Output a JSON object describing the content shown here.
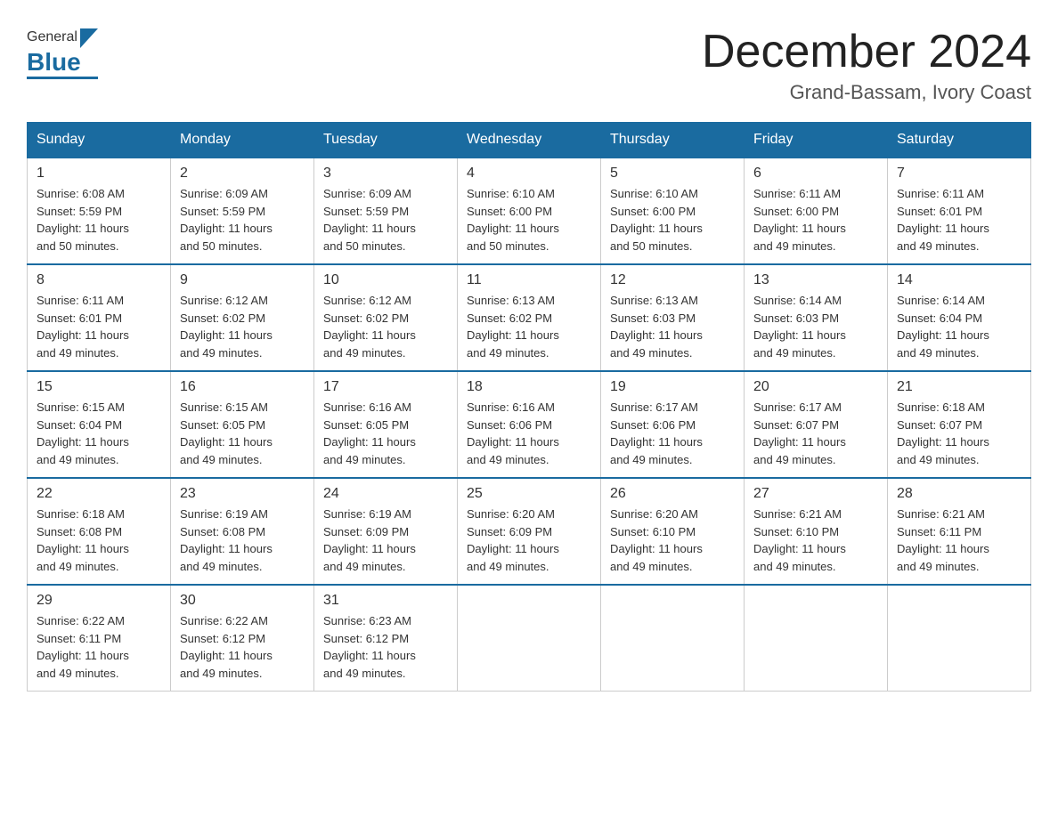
{
  "header": {
    "logo_general": "General",
    "logo_blue": "Blue",
    "month_title": "December 2024",
    "location": "Grand-Bassam, Ivory Coast"
  },
  "days_of_week": [
    "Sunday",
    "Monday",
    "Tuesday",
    "Wednesday",
    "Thursday",
    "Friday",
    "Saturday"
  ],
  "weeks": [
    [
      {
        "day": "1",
        "sunrise": "6:08 AM",
        "sunset": "5:59 PM",
        "daylight": "11 hours and 50 minutes."
      },
      {
        "day": "2",
        "sunrise": "6:09 AM",
        "sunset": "5:59 PM",
        "daylight": "11 hours and 50 minutes."
      },
      {
        "day": "3",
        "sunrise": "6:09 AM",
        "sunset": "5:59 PM",
        "daylight": "11 hours and 50 minutes."
      },
      {
        "day": "4",
        "sunrise": "6:10 AM",
        "sunset": "6:00 PM",
        "daylight": "11 hours and 50 minutes."
      },
      {
        "day": "5",
        "sunrise": "6:10 AM",
        "sunset": "6:00 PM",
        "daylight": "11 hours and 50 minutes."
      },
      {
        "day": "6",
        "sunrise": "6:11 AM",
        "sunset": "6:00 PM",
        "daylight": "11 hours and 49 minutes."
      },
      {
        "day": "7",
        "sunrise": "6:11 AM",
        "sunset": "6:01 PM",
        "daylight": "11 hours and 49 minutes."
      }
    ],
    [
      {
        "day": "8",
        "sunrise": "6:11 AM",
        "sunset": "6:01 PM",
        "daylight": "11 hours and 49 minutes."
      },
      {
        "day": "9",
        "sunrise": "6:12 AM",
        "sunset": "6:02 PM",
        "daylight": "11 hours and 49 minutes."
      },
      {
        "day": "10",
        "sunrise": "6:12 AM",
        "sunset": "6:02 PM",
        "daylight": "11 hours and 49 minutes."
      },
      {
        "day": "11",
        "sunrise": "6:13 AM",
        "sunset": "6:02 PM",
        "daylight": "11 hours and 49 minutes."
      },
      {
        "day": "12",
        "sunrise": "6:13 AM",
        "sunset": "6:03 PM",
        "daylight": "11 hours and 49 minutes."
      },
      {
        "day": "13",
        "sunrise": "6:14 AM",
        "sunset": "6:03 PM",
        "daylight": "11 hours and 49 minutes."
      },
      {
        "day": "14",
        "sunrise": "6:14 AM",
        "sunset": "6:04 PM",
        "daylight": "11 hours and 49 minutes."
      }
    ],
    [
      {
        "day": "15",
        "sunrise": "6:15 AM",
        "sunset": "6:04 PM",
        "daylight": "11 hours and 49 minutes."
      },
      {
        "day": "16",
        "sunrise": "6:15 AM",
        "sunset": "6:05 PM",
        "daylight": "11 hours and 49 minutes."
      },
      {
        "day": "17",
        "sunrise": "6:16 AM",
        "sunset": "6:05 PM",
        "daylight": "11 hours and 49 minutes."
      },
      {
        "day": "18",
        "sunrise": "6:16 AM",
        "sunset": "6:06 PM",
        "daylight": "11 hours and 49 minutes."
      },
      {
        "day": "19",
        "sunrise": "6:17 AM",
        "sunset": "6:06 PM",
        "daylight": "11 hours and 49 minutes."
      },
      {
        "day": "20",
        "sunrise": "6:17 AM",
        "sunset": "6:07 PM",
        "daylight": "11 hours and 49 minutes."
      },
      {
        "day": "21",
        "sunrise": "6:18 AM",
        "sunset": "6:07 PM",
        "daylight": "11 hours and 49 minutes."
      }
    ],
    [
      {
        "day": "22",
        "sunrise": "6:18 AM",
        "sunset": "6:08 PM",
        "daylight": "11 hours and 49 minutes."
      },
      {
        "day": "23",
        "sunrise": "6:19 AM",
        "sunset": "6:08 PM",
        "daylight": "11 hours and 49 minutes."
      },
      {
        "day": "24",
        "sunrise": "6:19 AM",
        "sunset": "6:09 PM",
        "daylight": "11 hours and 49 minutes."
      },
      {
        "day": "25",
        "sunrise": "6:20 AM",
        "sunset": "6:09 PM",
        "daylight": "11 hours and 49 minutes."
      },
      {
        "day": "26",
        "sunrise": "6:20 AM",
        "sunset": "6:10 PM",
        "daylight": "11 hours and 49 minutes."
      },
      {
        "day": "27",
        "sunrise": "6:21 AM",
        "sunset": "6:10 PM",
        "daylight": "11 hours and 49 minutes."
      },
      {
        "day": "28",
        "sunrise": "6:21 AM",
        "sunset": "6:11 PM",
        "daylight": "11 hours and 49 minutes."
      }
    ],
    [
      {
        "day": "29",
        "sunrise": "6:22 AM",
        "sunset": "6:11 PM",
        "daylight": "11 hours and 49 minutes."
      },
      {
        "day": "30",
        "sunrise": "6:22 AM",
        "sunset": "6:12 PM",
        "daylight": "11 hours and 49 minutes."
      },
      {
        "day": "31",
        "sunrise": "6:23 AM",
        "sunset": "6:12 PM",
        "daylight": "11 hours and 49 minutes."
      },
      null,
      null,
      null,
      null
    ]
  ],
  "labels": {
    "sunrise": "Sunrise:",
    "sunset": "Sunset:",
    "daylight": "Daylight:"
  }
}
